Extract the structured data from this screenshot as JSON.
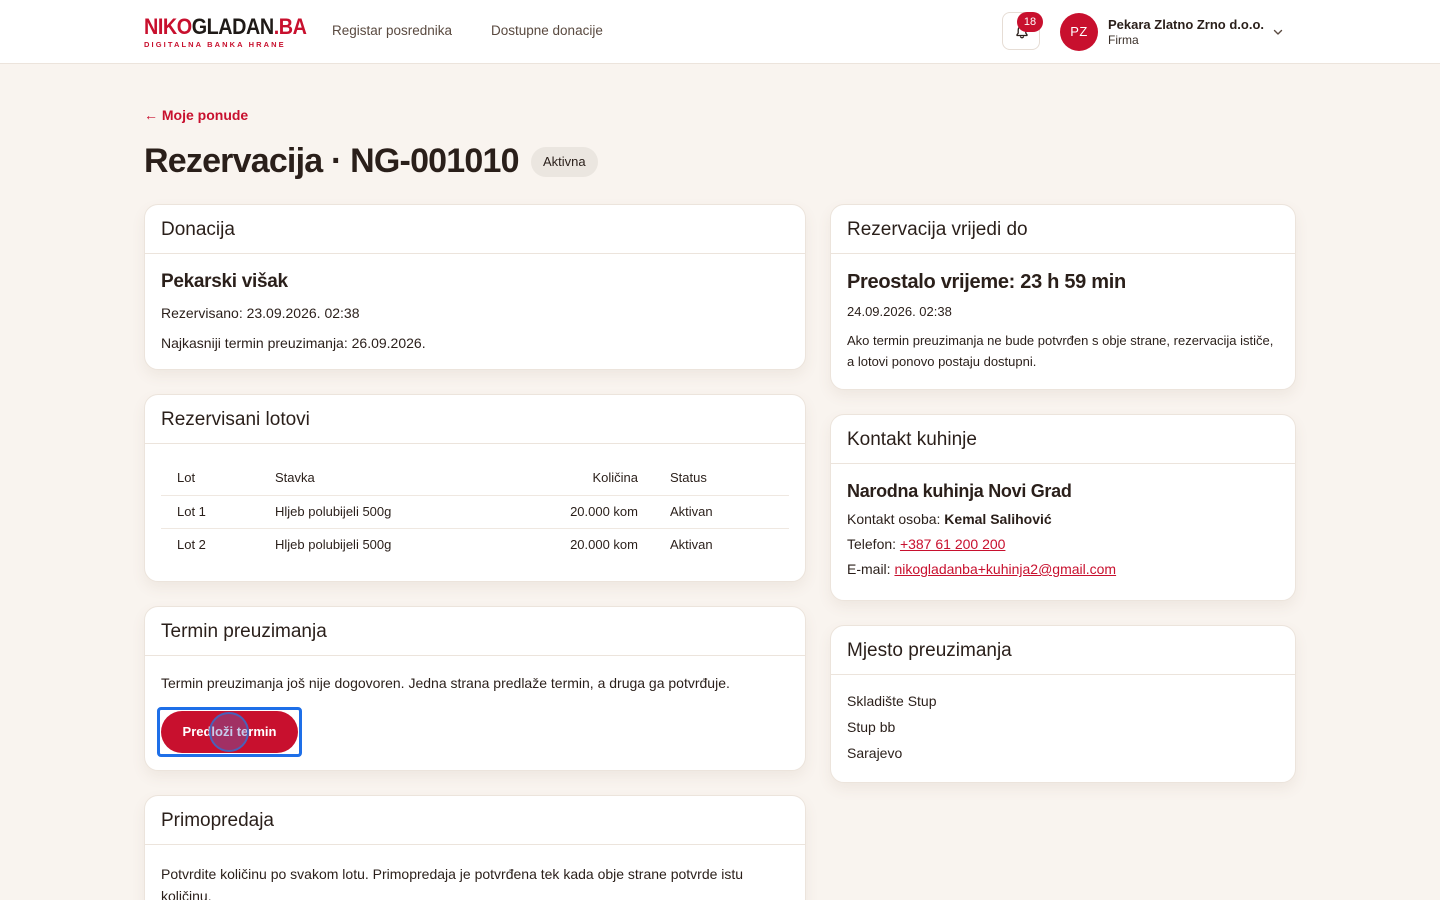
{
  "header": {
    "logo_part1": "NIKO",
    "logo_part2": "GLADAN",
    "logo_part3": ".BA",
    "logo_tagline": "DIGITALNA BANKA HRANE",
    "nav": [
      "Registar posrednika",
      "Dostupne donacije"
    ],
    "notifications_count": "18",
    "user_initials": "PZ",
    "user_name": "Pekara Zlatno Zrno d.o.o.",
    "user_role": "Firma"
  },
  "page": {
    "back_label": "← Moje ponude",
    "title": "Rezervacija · NG-001010",
    "status": "Aktivna"
  },
  "donation": {
    "heading": "Donacija",
    "name": "Pekarski višak",
    "reserved": "Rezervisano: 23.09.2026. 02:38",
    "latest_pickup": "Najkasniji termin preuzimanja: 26.09.2026."
  },
  "lots": {
    "heading": "Rezervisani lotovi",
    "columns": [
      "Lot",
      "Stavka",
      "Količina",
      "Status"
    ],
    "rows": [
      [
        "Lot 1",
        "Hljeb polubijeli 500g",
        "20.000 kom",
        "Aktivan"
      ],
      [
        "Lot 2",
        "Hljeb polubijeli 500g",
        "20.000 kom",
        "Aktivan"
      ]
    ]
  },
  "pickup_term": {
    "heading": "Termin preuzimanja",
    "text": "Termin preuzimanja još nije dogovoren. Jedna strana predlaže termin, a druga ga potvrđuje.",
    "button": "Predloži termin"
  },
  "handover": {
    "heading": "Primopredaja",
    "text": "Potvrdite količinu po svakom lotu. Primopredaja je potvrđena tek kada obje strane potvrde istu količinu."
  },
  "validity": {
    "heading": "Rezervacija vrijedi do",
    "remaining": "Preostalo vrijeme: 23 h 59 min",
    "until": "24.09.2026. 02:38",
    "note": "Ako termin preuzimanja ne bude potvrđen s obje strane, rezervacija ističe, a lotovi ponovo postaju dostupni."
  },
  "kitchen": {
    "heading": "Kontakt kuhinje",
    "name": "Narodna kuhinja Novi Grad",
    "contact_label": "Kontakt osoba: ",
    "contact_person": "Kemal Salihović",
    "phone_label": "Telefon: ",
    "phone": "+387 61 200 200",
    "email_label": "E-mail: ",
    "email": "nikogladanba+kuhinja2@gmail.com"
  },
  "location": {
    "heading": "Mjesto preuzimanja",
    "lines": [
      "Skladište Stup",
      "Stup bb",
      "Sarajevo"
    ]
  },
  "colors": {
    "brand": "#c8102e",
    "background": "#f9f4ef",
    "focus": "#1e6fe8"
  }
}
